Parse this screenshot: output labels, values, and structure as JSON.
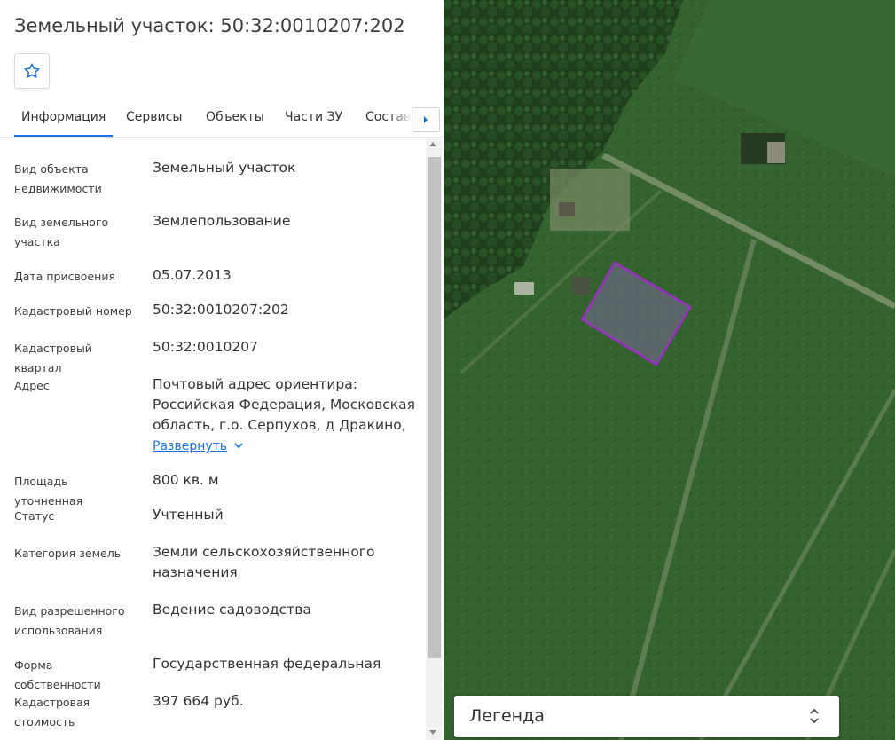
{
  "header": {
    "title": "Земельный участок: 50:32:0010207:202",
    "favorite_icon": "star-outline-icon"
  },
  "tabs": [
    {
      "label": "Информация",
      "active": true
    },
    {
      "label": "Сервисы"
    },
    {
      "label": "Объекты"
    },
    {
      "label": "Части ЗУ"
    },
    {
      "label": "Состав"
    }
  ],
  "fields": [
    {
      "label": "Вид объекта недвижимости",
      "value": "Земельный участок"
    },
    {
      "label": "Вид земельного участка",
      "value": "Землепользование"
    },
    {
      "label": "Дата присвоения",
      "value": "05.07.2013"
    },
    {
      "label": "Кадастровый номер",
      "value": "50:32:0010207:202"
    },
    {
      "label": "Кадастровый квартал",
      "value": "50:32:0010207"
    },
    {
      "label": "Адрес",
      "value": "Почтовый адрес ориентира: Российская Федерация, Московская область, г.о. Серпухов, д Дракино,",
      "expand_label": "Развернуть"
    },
    {
      "label": "Площадь уточненная",
      "value": "800 кв. м"
    },
    {
      "label": "Статус",
      "value": "Учтенный"
    },
    {
      "label": "Категория земель",
      "value": "Земли сельскохозяйственного назначения"
    },
    {
      "label": "Вид разрешенного использования",
      "value": "Ведение садоводства"
    },
    {
      "label": "Форма собственности",
      "value": "Государственная федеральная"
    },
    {
      "label": "Кадастровая стоимость",
      "value": "397 664 руб."
    }
  ],
  "map": {
    "parcel_color": "#9b2fc4",
    "legend_label": "Легенда",
    "legend_icon": "chevron-up-down-icon"
  },
  "colors": {
    "accent": "#1a73e8"
  }
}
